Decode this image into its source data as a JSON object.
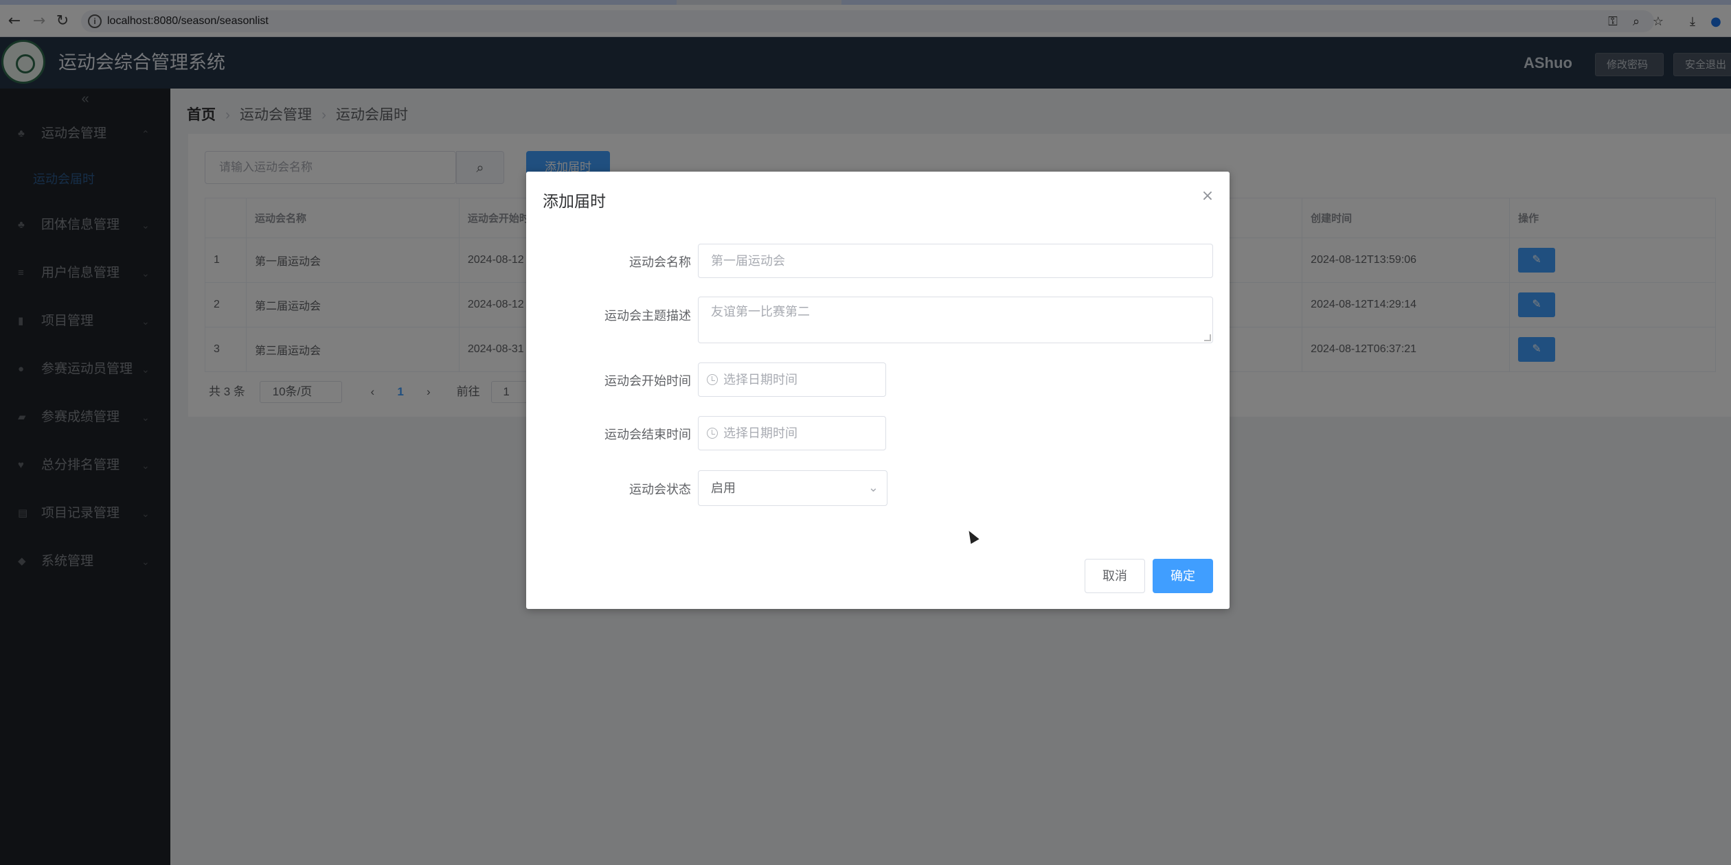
{
  "browser": {
    "url": "localhost:8080/season/seasonlist",
    "back_icon": "←",
    "forward_icon": "→",
    "reload_icon": "↻",
    "key_icon": "⚿",
    "zoom_icon": "⌕",
    "star_icon": "☆",
    "download_icon": "⤓",
    "profile_icon": "●"
  },
  "header": {
    "title": "运动会综合管理系统",
    "username": "AShuo",
    "change_password": "修改密码",
    "logout": "安全退出"
  },
  "sidebar": {
    "collapse_icon": "«",
    "items": [
      {
        "label": "运动会管理",
        "icon": "♣",
        "arrow": "⌃"
      },
      {
        "label": "团体信息管理",
        "icon": "♣",
        "arrow": "⌄"
      },
      {
        "label": "用户信息管理",
        "icon": "≡",
        "arrow": "⌄"
      },
      {
        "label": "项目管理",
        "icon": "▮",
        "arrow": "⌄"
      },
      {
        "label": "参赛运动员管理",
        "icon": "●",
        "arrow": "⌄"
      },
      {
        "label": "参赛成绩管理",
        "icon": "▰",
        "arrow": "⌄"
      },
      {
        "label": "总分排名管理",
        "icon": "♥",
        "arrow": "⌄"
      },
      {
        "label": "项目记录管理",
        "icon": "▤",
        "arrow": "⌄"
      },
      {
        "label": "系统管理",
        "icon": "◆",
        "arrow": "⌄"
      }
    ],
    "submenu": {
      "label": "运动会届时"
    }
  },
  "breadcrumb": {
    "home": "首页",
    "level1": "运动会管理",
    "level2": "运动会届时",
    "sep": "›"
  },
  "toolbar": {
    "search_placeholder": "请输入运动会名称",
    "search_icon": "⌕",
    "add_button": "添加届时"
  },
  "table": {
    "headers": [
      "",
      "运动会名称",
      "运动会开始时间",
      "创建时间",
      "操作"
    ],
    "rows": [
      {
        "index": "1",
        "name": "第一届运动会",
        "start": "2024-08-12",
        "created": "2024-08-12T13:59:06",
        "edit": "✎"
      },
      {
        "index": "2",
        "name": "第二届运动会",
        "start": "2024-08-12",
        "created": "2024-08-12T14:29:14",
        "edit": "✎"
      },
      {
        "index": "3",
        "name": "第三届运动会",
        "start": "2024-08-31",
        "created": "2024-08-12T06:37:21",
        "edit": "✎"
      }
    ]
  },
  "pagination": {
    "total": "共 3 条",
    "size": "10条/页",
    "prev": "‹",
    "current": "1",
    "next": "›",
    "goto_label": "前往",
    "goto_value": "1"
  },
  "dialog": {
    "title": "添加届时",
    "close_icon": "×",
    "fields": {
      "name": {
        "label": "运动会名称",
        "placeholder": "第一届运动会"
      },
      "theme": {
        "label": "运动会主题描述",
        "placeholder": "友谊第一比赛第二"
      },
      "start": {
        "label": "运动会开始时间",
        "placeholder": "选择日期时间"
      },
      "end": {
        "label": "运动会结束时间",
        "placeholder": "选择日期时间"
      },
      "status": {
        "label": "运动会状态",
        "value": "启用",
        "chevron": "⌄"
      }
    },
    "cancel": "取消",
    "confirm": "确定"
  },
  "colors": {
    "primary": "#409eff",
    "header_bg": "#243447",
    "sidebar_bg": "#1f2329"
  }
}
